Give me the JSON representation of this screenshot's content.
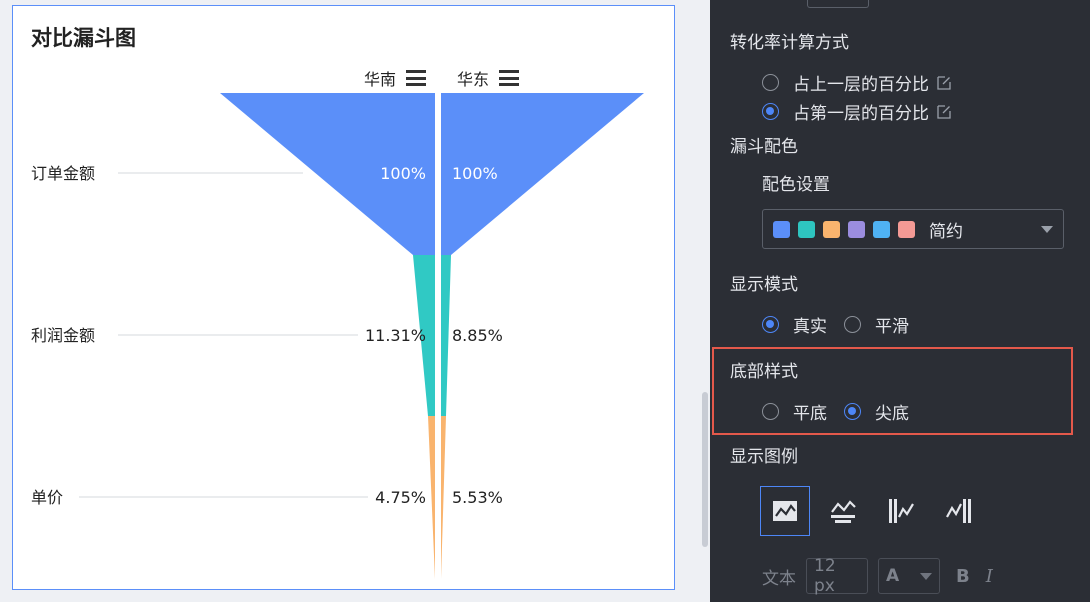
{
  "chart_card": {
    "title": "对比漏斗图",
    "legend": [
      {
        "name": "华南",
        "icon": "menu-icon"
      },
      {
        "name": "华东",
        "icon": "menu-icon"
      }
    ]
  },
  "chart_data": {
    "type": "funnel",
    "categories": [
      "订单金额",
      "利润金额",
      "单价"
    ],
    "series": [
      {
        "name": "华南",
        "values_pct": [
          100,
          11.31,
          4.75
        ],
        "labels": [
          "100%",
          "11.31%",
          "4.75%"
        ]
      },
      {
        "name": "华东",
        "values_pct": [
          100,
          8.85,
          5.53
        ],
        "labels": [
          "100%",
          "8.85%",
          "5.53%"
        ]
      }
    ],
    "colors": [
      "#5b8ff9",
      "#30c9c4",
      "#f9b46e"
    ],
    "bottom_style": "pointed",
    "mode": "real"
  },
  "panel": {
    "conversion": {
      "title": "转化率计算方式",
      "options": [
        {
          "label": "占上一层的百分比",
          "selected": false,
          "icon": "edit-icon"
        },
        {
          "label": "占第一层的百分比",
          "selected": true,
          "icon": "edit-icon"
        }
      ]
    },
    "funnel_color": {
      "title": "漏斗配色",
      "sub_title": "配色设置",
      "scheme_name": "简约",
      "swatches": [
        "#5b8ff9",
        "#2ec5c0",
        "#f9b46e",
        "#9b8ddf",
        "#4fb2f3",
        "#f49a95"
      ]
    },
    "display_mode": {
      "title": "显示模式",
      "options": [
        {
          "label": "真实",
          "selected": true
        },
        {
          "label": "平滑",
          "selected": false
        }
      ]
    },
    "bottom_style": {
      "title": "底部样式",
      "options": [
        {
          "label": "平底",
          "selected": false
        },
        {
          "label": "尖底",
          "selected": true
        }
      ]
    },
    "show_legend": {
      "title": "显示图例",
      "options": [
        "legend-top-icon",
        "legend-bottom-icon",
        "legend-left-icon",
        "legend-right-icon"
      ],
      "selected_index": 0
    },
    "text": {
      "label": "文本",
      "font_size": "12 px",
      "color_letter": "A",
      "bold": "B",
      "italic": "I"
    }
  },
  "colors": {
    "accent": "#4d86f7",
    "highlight": "#e4594b",
    "panel_bg": "#2b2e35"
  }
}
